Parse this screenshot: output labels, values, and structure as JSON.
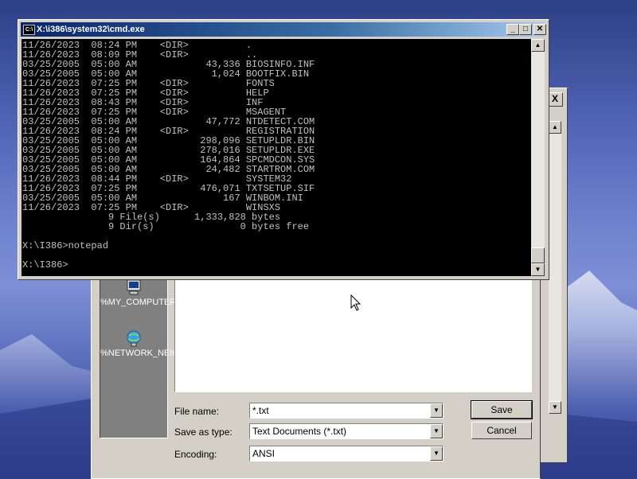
{
  "cmd": {
    "title": "X:\\i386\\system32\\cmd.exe",
    "icon_label": "C:\\",
    "lines": [
      "11/26/2023  08:24 PM    <DIR>          .",
      "11/26/2023  08:09 PM    <DIR>          ..",
      "03/25/2005  05:00 AM            43,336 BIOSINFO.INF",
      "03/25/2005  05:00 AM             1,024 BOOTFIX.BIN",
      "11/26/2023  07:25 PM    <DIR>          FONTS",
      "11/26/2023  07:25 PM    <DIR>          HELP",
      "11/26/2023  08:43 PM    <DIR>          INF",
      "11/26/2023  07:25 PM    <DIR>          MSAGENT",
      "03/25/2005  05:00 AM            47,772 NTDETECT.COM",
      "11/26/2023  08:24 PM    <DIR>          REGISTRATION",
      "03/25/2005  05:00 AM           298,096 SETUPLDR.BIN",
      "03/25/2005  05:00 AM           278,016 SETUPLDR.EXE",
      "03/25/2005  05:00 AM           164,864 SPCMDCON.SYS",
      "03/25/2005  05:00 AM            24,482 STARTROM.COM",
      "11/26/2023  08:44 PM    <DIR>          SYSTEM32",
      "11/26/2023  07:25 PM           476,071 TXTSETUP.SIF",
      "03/25/2005  05:00 AM               167 WINBOM.INI",
      "11/26/2023  07:25 PM    <DIR>          WINSXS",
      "               9 File(s)      1,333,828 bytes",
      "               9 Dir(s)               0 bytes free",
      "",
      "X:\\I386>notepad",
      "",
      "X:\\I386>"
    ]
  },
  "dialog": {
    "places": [
      {
        "label": "%MY_COMPUTER%",
        "icon": "my-computer-icon"
      },
      {
        "label": "%NETWORK_NEIGHBORH...",
        "icon": "network-neighborhood-icon"
      }
    ],
    "file_name_label": "File name:",
    "file_name_value": "*.txt",
    "save_as_type_label": "Save as type:",
    "save_as_type_value": "Text Documents (*.txt)",
    "encoding_label": "Encoding:",
    "encoding_value": "ANSI",
    "save_label": "Save",
    "cancel_label": "Cancel"
  },
  "background_window": {
    "close_label": "X"
  },
  "colors": {
    "titlebar_active": "#0a246a",
    "console_bg": "#000000",
    "console_fg": "#c0c0c0",
    "dialog_face": "#d4d0c8"
  }
}
